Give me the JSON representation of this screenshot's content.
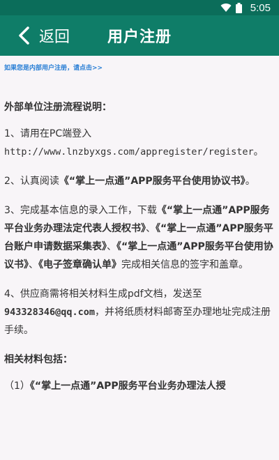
{
  "statusbar": {
    "time": "5:05"
  },
  "header": {
    "back_label": "返回",
    "title": "用户注册"
  },
  "internal_link": "如果您是内部用户注册，请点击>>",
  "section_title": "外部单位注册流程说明：",
  "steps": {
    "s1_pre": "1、请用在PC端登入",
    "s1_url": "http://www.lnzbyxgs.com/appregister/register",
    "s1_post": "。",
    "s2_pre": "2、认真阅读",
    "s2_doc": "《“掌上一点通”APP服务平台使用协议书》",
    "s2_post": "。",
    "s3_pre": "3、完成基本信息的录入工作，下载",
    "s3_doc1": "《“掌上一点通”APP服务平台业务办理法定代表人授权书》",
    "s3_sep1": "、",
    "s3_doc2": "《“掌上一点通”APP服务平台账户申请数据采集表》",
    "s3_sep2": "、",
    "s3_doc3": "《“掌上一点通”APP服务平台使用协议书》",
    "s3_sep3": "、",
    "s3_doc4": "《电子签章确认单》",
    "s3_post": "完成相关信息的签字和盖章。",
    "s4_pre": "4、供应商需将相关材料生成pdf文档，发送至",
    "s4_email": "943328346@qq.com",
    "s4_post": "，并将纸质材料邮寄至办理地址完成注册手续。"
  },
  "materials_title": "相关材料包括：",
  "materials": [
    {
      "prefix": "（1）",
      "doc": "《“掌上一点通”APP服务平台业务办理法人授"
    }
  ],
  "icons": [
    "wifi-icon",
    "battery-icon",
    "chevron-left-icon"
  ],
  "colors": {
    "statusbar": "#0b6d5a",
    "appbar": "#0f7d68",
    "link": "#2a7fd5",
    "background": "#f8f5f8"
  }
}
